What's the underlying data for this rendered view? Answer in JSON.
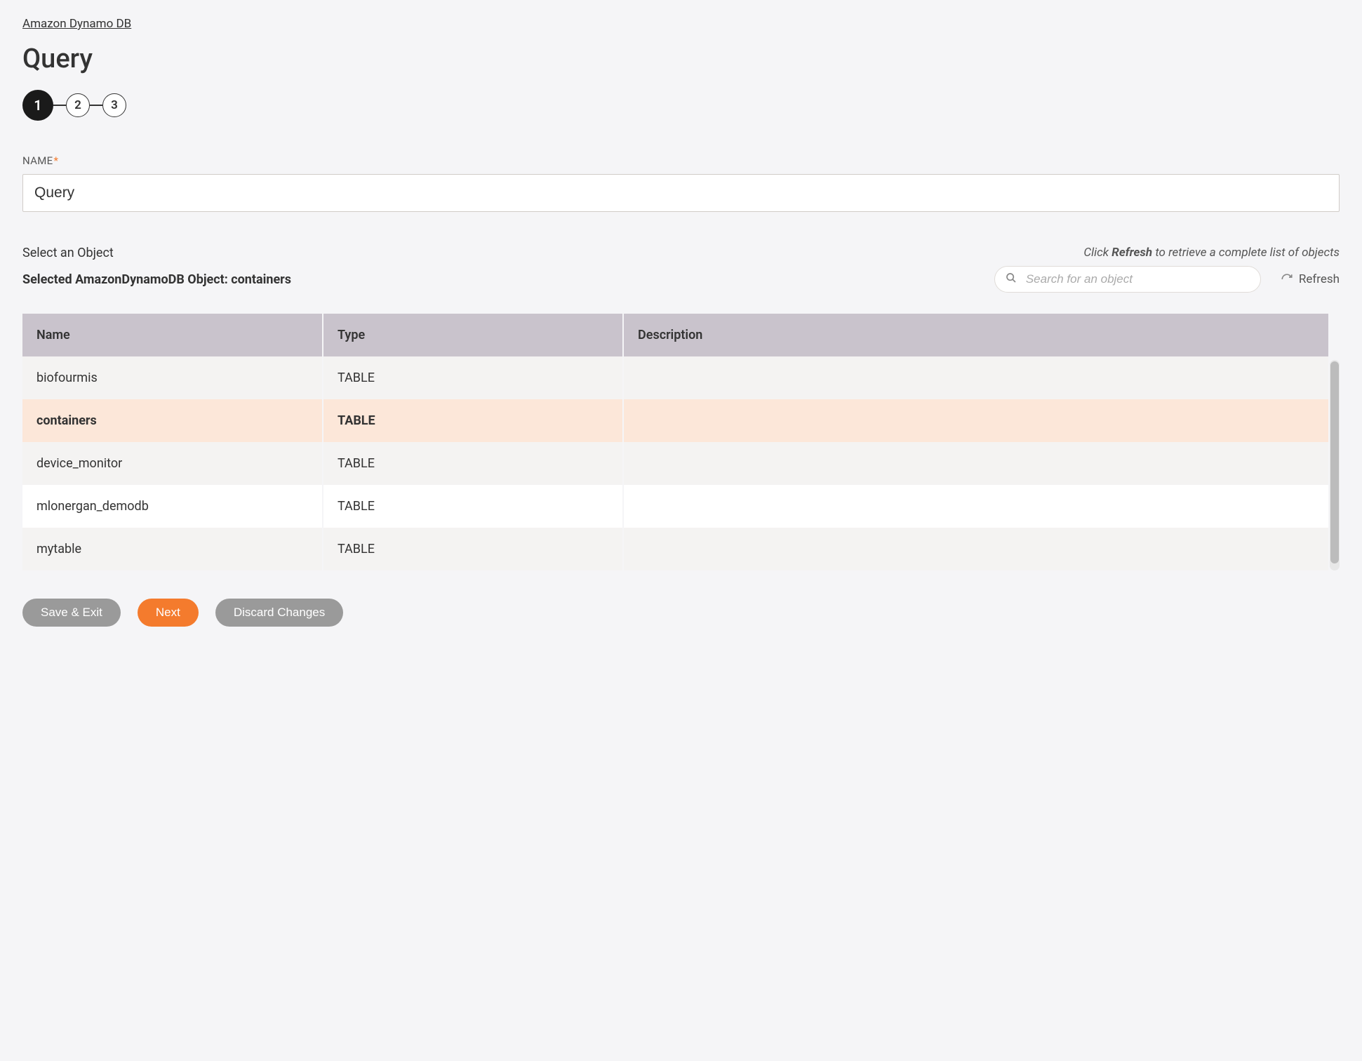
{
  "breadcrumb": "Amazon Dynamo DB",
  "title": "Query",
  "stepper": {
    "steps": [
      "1",
      "2",
      "3"
    ],
    "active_index": 0
  },
  "name_field": {
    "label": "NAME",
    "required_mark": "*",
    "value": "Query"
  },
  "object_section": {
    "select_label": "Select an Object",
    "hint_prefix": "Click ",
    "hint_bold": "Refresh",
    "hint_suffix": " to retrieve a complete list of objects",
    "selected_label": "Selected AmazonDynamoDB Object: containers",
    "search_placeholder": "Search for an object",
    "refresh_label": "Refresh"
  },
  "table": {
    "headers": {
      "name": "Name",
      "type": "Type",
      "description": "Description"
    },
    "rows": [
      {
        "name": "biofourmis",
        "type": "TABLE",
        "description": "",
        "selected": false
      },
      {
        "name": "containers",
        "type": "TABLE",
        "description": "",
        "selected": true
      },
      {
        "name": "device_monitor",
        "type": "TABLE",
        "description": "",
        "selected": false
      },
      {
        "name": "mlonergan_demodb",
        "type": "TABLE",
        "description": "",
        "selected": false
      },
      {
        "name": "mytable",
        "type": "TABLE",
        "description": "",
        "selected": false
      }
    ]
  },
  "actions": {
    "save_exit": "Save & Exit",
    "next": "Next",
    "discard": "Discard Changes"
  }
}
